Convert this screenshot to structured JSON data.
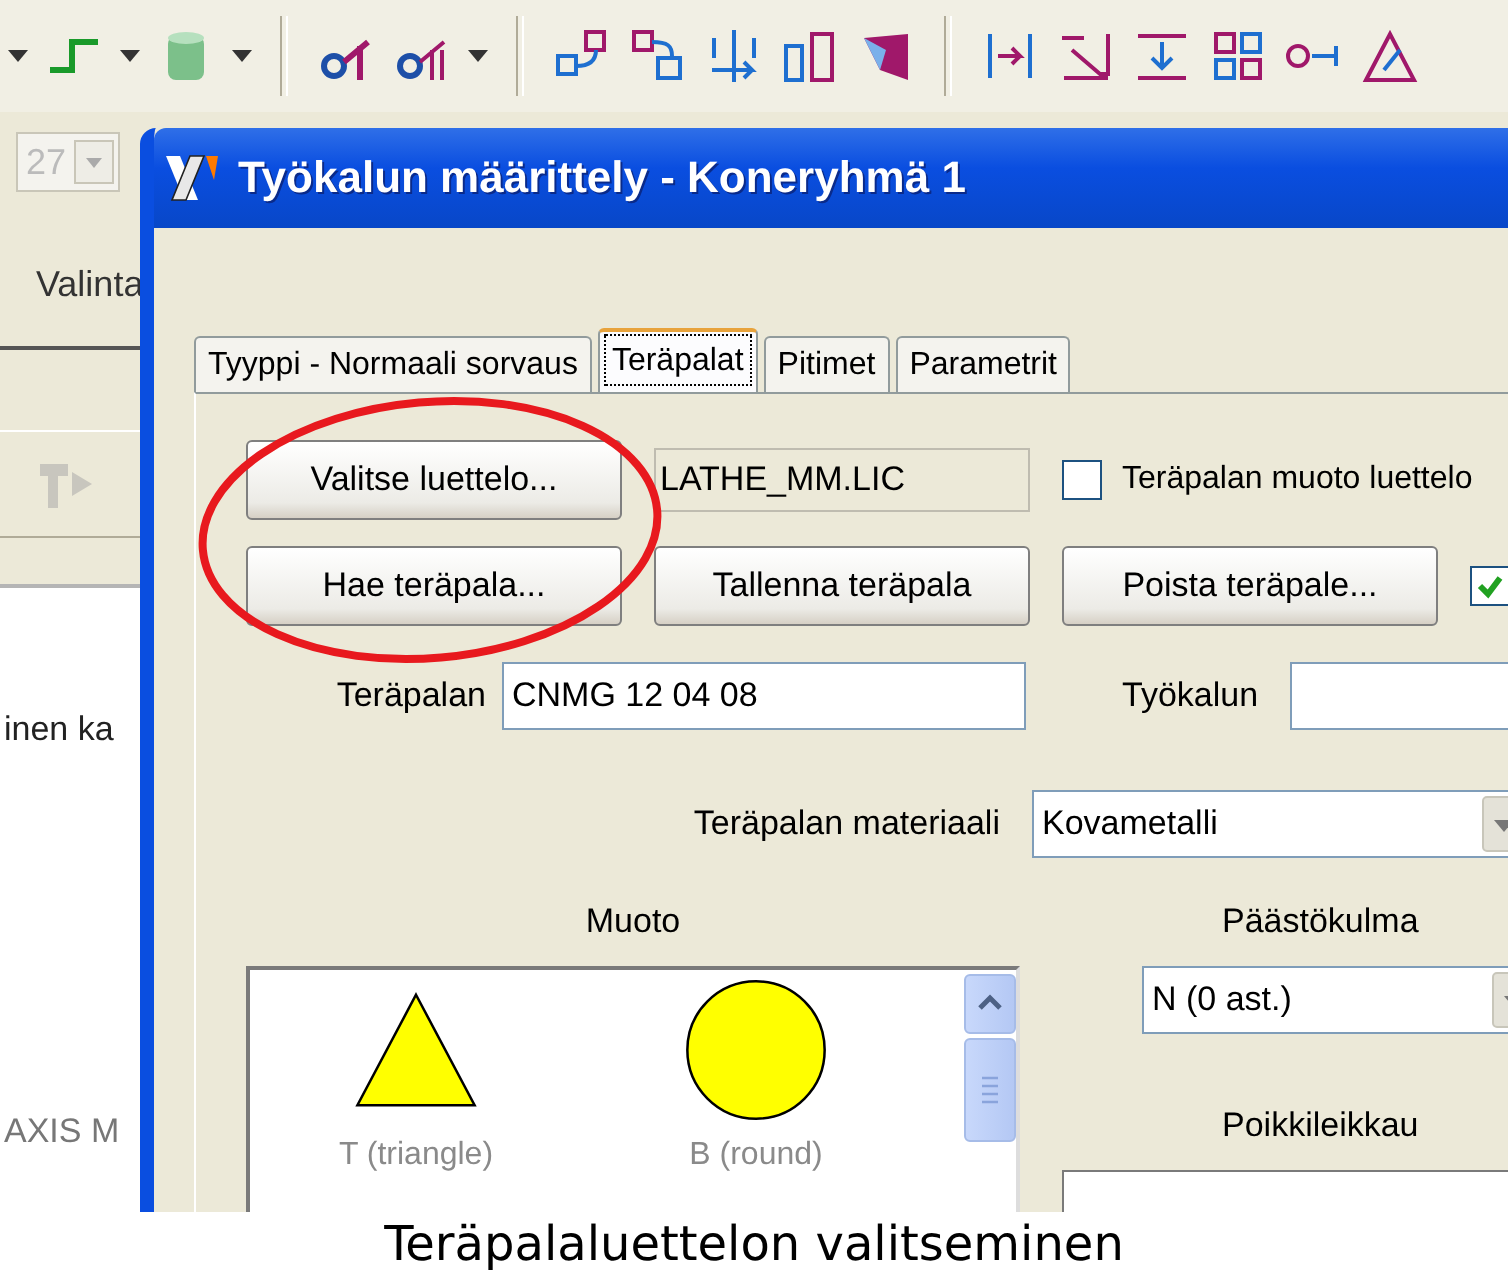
{
  "background_window": {
    "combo_value": "27",
    "tab_label": "Valinta",
    "list_text": "inen ka",
    "axis_text": "AXIS M"
  },
  "dialog": {
    "title": "Työkalun määrittely - Koneryhmä 1",
    "tabs": [
      {
        "label": "Tyyppi - Normaali sorvaus",
        "selected": false
      },
      {
        "label": "Teräpalat",
        "selected": true
      },
      {
        "label": "Pitimet",
        "selected": false
      },
      {
        "label": "Parametrit",
        "selected": false
      }
    ],
    "catalog_button": "Valitse luettelo...",
    "catalog_file": "LATHE_MM.LIC",
    "shape_from_catalog": {
      "label": "Teräpalan muoto luettelo",
      "checked": false
    },
    "buttons": [
      "Hae teräpala...",
      "Tallenna teräpala",
      "Poista teräpale..."
    ],
    "extra_checkbox": {
      "checked": true
    },
    "insert_name": {
      "label": "Teräpalan",
      "value": "CNMG 12 04 08"
    },
    "tool_name": {
      "label": "Työkalun"
    },
    "material": {
      "label": "Teräpalan materiaali",
      "value": "Kovametalli"
    },
    "shape": {
      "heading": "Muoto",
      "items": [
        {
          "kind": "triangle",
          "label": "T (triangle)"
        },
        {
          "kind": "round",
          "label": "B (round)"
        }
      ]
    },
    "clearance": {
      "heading": "Päästökulma",
      "value": "N (0 ast.)"
    },
    "cross_section": {
      "heading": "Poikkileikkau"
    }
  },
  "caption": "Teräpalaluettelon valitseminen"
}
